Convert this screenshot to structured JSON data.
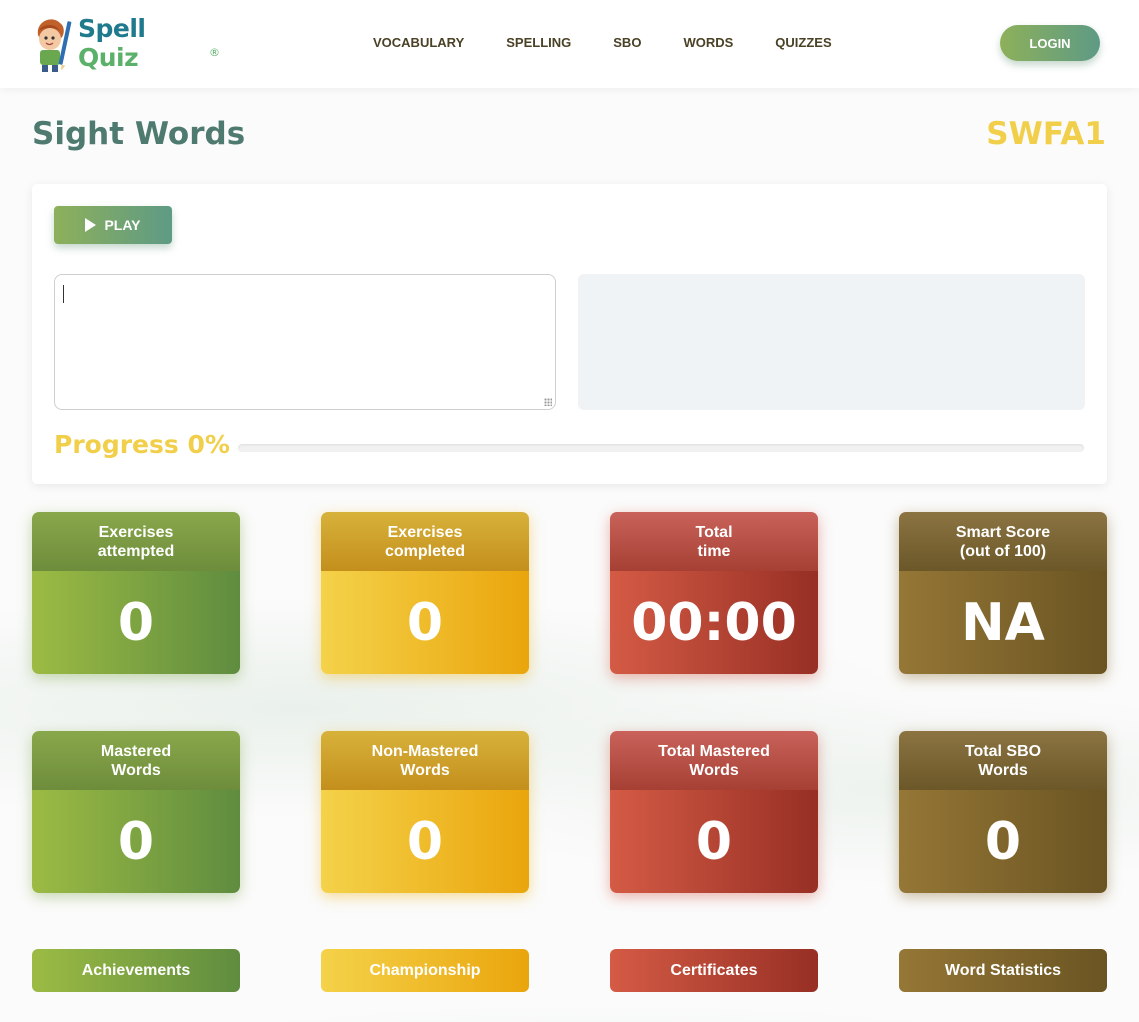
{
  "header": {
    "logo_part1": "Spell",
    "logo_part2": "Quiz",
    "logo_mark": "®",
    "nav": [
      "VOCABULARY",
      "SPELLING",
      "SBO",
      "WORDS",
      "QUIZZES"
    ],
    "login_label": "LOGIN"
  },
  "page": {
    "title": "Sight Words",
    "code": "SWFA1"
  },
  "exercise": {
    "play_label": "PLAY",
    "answer_value": "",
    "progress_label": "Progress 0%",
    "progress_fraction": 0
  },
  "stats_row1": [
    {
      "title": "Exercises\nattempted",
      "value": "0",
      "color": "green"
    },
    {
      "title": "Exercises\ncompleted",
      "value": "0",
      "color": "yellow"
    },
    {
      "title": "Total\ntime",
      "value": "00:00",
      "color": "red"
    },
    {
      "title": "Smart Score\n(out of 100)",
      "value": "NA",
      "color": "brown"
    }
  ],
  "stats_row2": [
    {
      "title": "Mastered\nWords",
      "value": "0",
      "color": "green"
    },
    {
      "title": "Non-Mastered\nWords",
      "value": "0",
      "color": "yellow"
    },
    {
      "title": "Total Mastered\nWords",
      "value": "0",
      "color": "red"
    },
    {
      "title": "Total SBO\nWords",
      "value": "0",
      "color": "brown"
    }
  ],
  "bottom_buttons": [
    "Achievements",
    "Championship",
    "Certificates",
    "Word Statistics"
  ],
  "colors": {
    "green": "#7fa444",
    "yellow": "#f1c232",
    "red": "#c04a3a",
    "brown": "#806530",
    "title": "#4e7a70",
    "accent": "#f1cf4a"
  },
  "icons": {
    "play": "play-icon",
    "mascot": "kid-with-pencil-mascot"
  }
}
